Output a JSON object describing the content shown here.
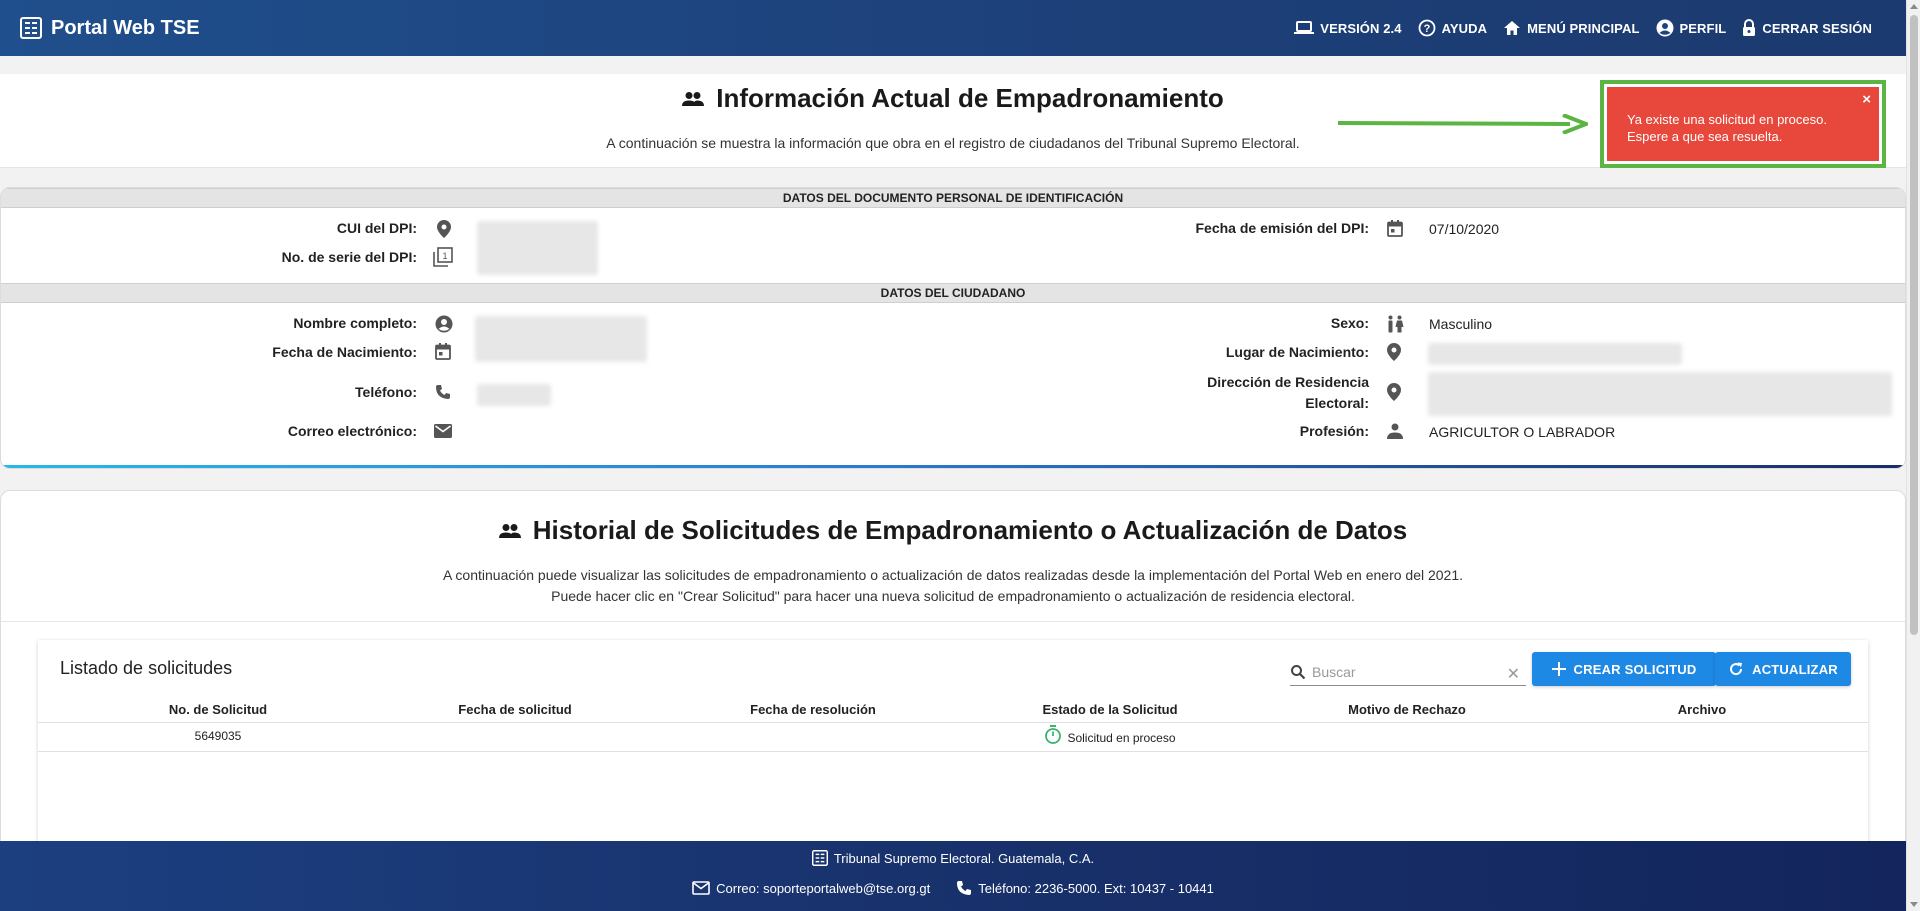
{
  "header": {
    "title": "Portal Web TSE",
    "nav": [
      {
        "icon": "laptop-icon",
        "label": "VERSIÓN 2.4"
      },
      {
        "icon": "help-icon",
        "label": "AYUDA"
      },
      {
        "icon": "home-icon",
        "label": "MENÚ PRINCIPAL"
      },
      {
        "icon": "account-icon",
        "label": "PERFIL"
      },
      {
        "icon": "lock-icon",
        "label": "CERRAR SESIÓN"
      }
    ]
  },
  "info": {
    "title": "Información Actual de Empadronamiento",
    "description": "A continuación se muestra la información que obra en el registro de ciudadanos del Tribunal Supremo Electoral.",
    "dpi_band": "DATOS DEL DOCUMENTO PERSONAL DE IDENTIFICACIÓN",
    "citizen_band": "DATOS DEL CIUDADANO",
    "fields": {
      "cui_label": "CUI del DPI:",
      "serie_label": "No. de serie del DPI:",
      "emision_label": "Fecha de emisión del DPI:",
      "emision_value": "07/10/2020",
      "nombre_label": "Nombre completo:",
      "nacimiento_label": "Fecha de Nacimiento:",
      "telefono_label": "Teléfono:",
      "correo_label": "Correo electrónico:",
      "sexo_label": "Sexo:",
      "sexo_value": "Masculino",
      "lugar_label": "Lugar de Nacimiento:",
      "direccion_label_1": "Dirección de Residencia",
      "direccion_label_2": "Electoral:",
      "profesion_label": "Profesión:",
      "profesion_value": "AGRICULTOR O LABRADOR"
    }
  },
  "toast": {
    "line1": "Ya existe una solicitud en proceso.",
    "line2": "Espere a que sea resuelta.",
    "close": "×",
    "color": "#e7483b",
    "highlight_color": "#5ab543"
  },
  "history": {
    "title": "Historial de Solicitudes de Empadronamiento o Actualización de Datos",
    "desc1": "A continuación puede visualizar las solicitudes de empadronamiento o actualización de datos realizadas desde la implementación del Portal Web en enero del 2021.",
    "desc2": "Puede hacer clic en \"Crear Solicitud\" para hacer una nueva solicitud de empadronamiento o actualización de residencia electoral.",
    "list_title": "Listado de solicitudes",
    "search_placeholder": "Buscar",
    "create_button": "CREAR SOLICITUD",
    "refresh_button": "ACTUALIZAR",
    "columns": [
      "No. de Solicitud",
      "Fecha de solicitud",
      "Fecha de resolución",
      "Estado de la Solicitud",
      "Motivo de Rechazo",
      "Archivo"
    ],
    "rows": [
      {
        "numero": "5649035",
        "fecha_solicitud": "",
        "fecha_resolucion": "",
        "estado": "Solicitud en proceso",
        "motivo": "",
        "archivo": ""
      }
    ]
  },
  "footer": {
    "org": "Tribunal Supremo Electoral. Guatemala, C.A.",
    "email": "Correo: soporteportalweb@tse.org.gt",
    "phone": "Teléfono: 2236-5000. Ext: 10437 - 10441"
  },
  "colors": {
    "primary_button": "#1e88e5",
    "header_bg": "#1f4f8c"
  }
}
